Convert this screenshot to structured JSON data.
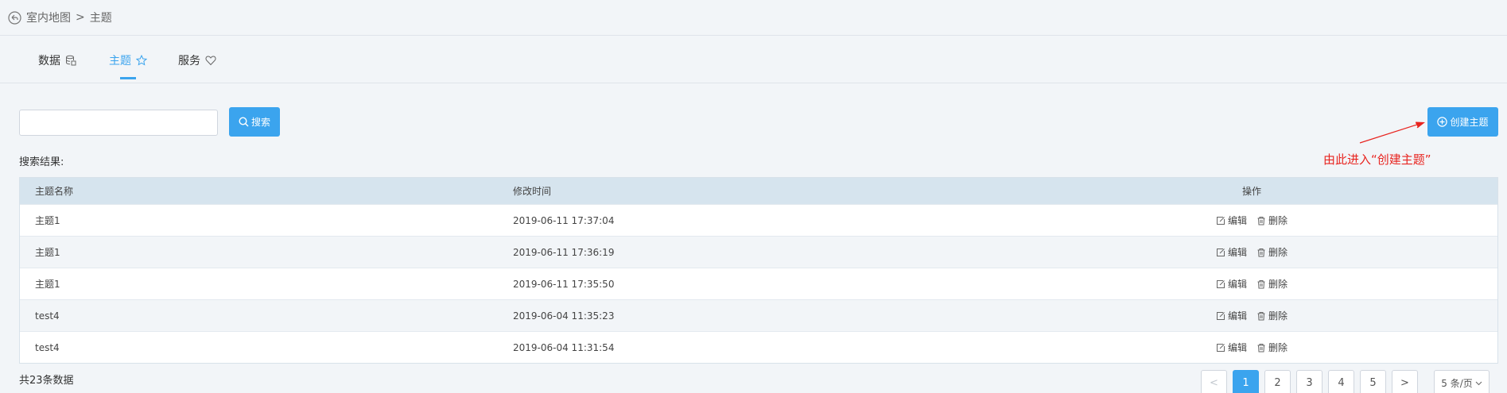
{
  "breadcrumb": {
    "parent": "室内地图",
    "separator": ">",
    "current": "主题"
  },
  "tabs": [
    {
      "label": "数据",
      "icon": "database-icon",
      "active": false
    },
    {
      "label": "主题",
      "icon": "star-icon",
      "active": true
    },
    {
      "label": "服务",
      "icon": "heart-icon",
      "active": false
    }
  ],
  "search": {
    "value": "",
    "placeholder": "",
    "button_label": "搜索"
  },
  "create_button_label": "创建主题",
  "annotation_text": "由此进入“创建主题”",
  "results_label": "搜索结果:",
  "table": {
    "headers": {
      "name": "主题名称",
      "time": "修改时间",
      "ops": "操作"
    },
    "rows": [
      {
        "name": "主题1",
        "time": "2019-06-11 17:37:04"
      },
      {
        "name": "主题1",
        "time": "2019-06-11 17:36:19"
      },
      {
        "name": "主题1",
        "time": "2019-06-11 17:35:50"
      },
      {
        "name": "test4",
        "time": "2019-06-04 11:35:23"
      },
      {
        "name": "test4",
        "time": "2019-06-04 11:31:54"
      }
    ],
    "edit_label": "编辑",
    "delete_label": "删除"
  },
  "total_text": "共23条数据",
  "pagination": {
    "prev": "<",
    "next": ">",
    "pages": [
      "1",
      "2",
      "3",
      "4",
      "5"
    ],
    "current": "1",
    "page_size": "5 条/页"
  },
  "colors": {
    "accent": "#3ba4ee",
    "annotation": "#e8241f",
    "background": "#f2f5f8",
    "table_header": "#d6e4ee"
  }
}
